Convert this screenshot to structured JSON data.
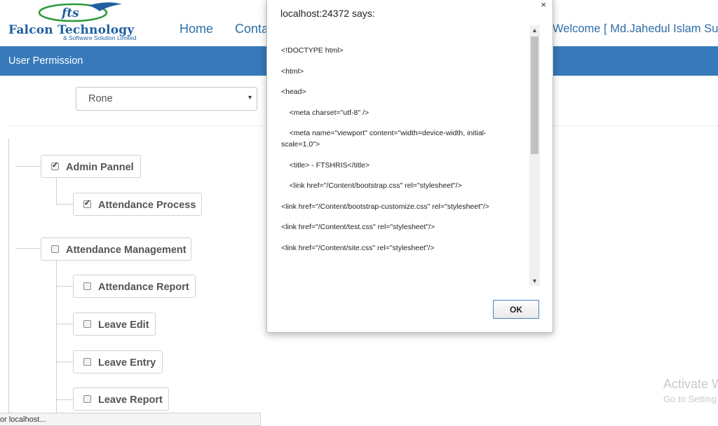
{
  "navbar": {
    "logo": {
      "mark": "fts",
      "title": "Falcon Technology",
      "subtitle": "& Software Solution Limited",
      "colors": {
        "primary": "#1f5fa0",
        "accent": "#2a9a3a"
      }
    },
    "links": {
      "home": "Home",
      "contact": "Conta"
    },
    "welcome": "Welcome [ Md.Jahedul Islam Sur"
  },
  "title_bar": {
    "label": "User Permission",
    "color": "#3779b9"
  },
  "user_select": {
    "value": "Rone",
    "caret": "▾"
  },
  "tree": {
    "admin_pannel": {
      "label": "Admin Pannel",
      "checked": true
    },
    "attendance_process": {
      "label": "Attendance Process",
      "checked": true
    },
    "attendance_management": {
      "label": "Attendance Management",
      "checked": false
    },
    "attendance_report": {
      "label": "Attendance Report",
      "checked": false
    },
    "leave_edit": {
      "label": "Leave Edit",
      "checked": false
    },
    "leave_entry": {
      "label": "Leave Entry",
      "checked": false
    },
    "leave_report": {
      "label": "Leave Report",
      "checked": false
    }
  },
  "dialog": {
    "title": "localhost:24372 says:",
    "close": "×",
    "lines": [
      "<!DOCTYPE html>",
      "<html>",
      "<head>",
      "    <meta charset=\"utf-8\" />",
      "    <meta name=\"viewport\" content=\"width=device-width, initial-scale=1.0\">",
      "    <title> - FTSHRIS</title>",
      "    <link href=\"/Content/bootstrap.css\" rel=\"stylesheet\"/>",
      "<link href=\"/Content/bootstrap-customize.css\" rel=\"stylesheet\"/>",
      "<link href=\"/Content/test.css\" rel=\"stylesheet\"/>",
      "<link href=\"/Content/site.css\" rel=\"stylesheet\"/>"
    ],
    "scroll_up": "▲",
    "scroll_down": "▼",
    "ok": "OK"
  },
  "watermark": {
    "title": "Activate W",
    "subtitle": "Go to Setting"
  },
  "status_bar": {
    "text": "or localhost..."
  }
}
